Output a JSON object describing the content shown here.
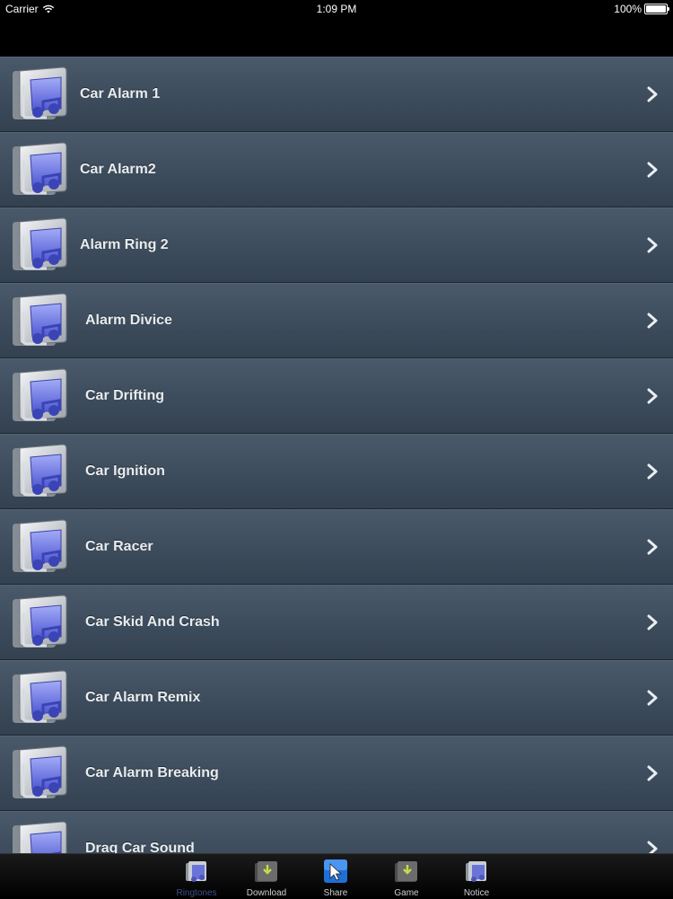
{
  "status": {
    "carrier": "Carrier",
    "time": "1:09 PM",
    "battery": "100%"
  },
  "rows": [
    {
      "label": "Car Alarm 1"
    },
    {
      "label": "Car Alarm2"
    },
    {
      "label": "Alarm Ring 2"
    },
    {
      "label": "Alarm Divice"
    },
    {
      "label": "Car Drifting"
    },
    {
      "label": "Car Ignition"
    },
    {
      "label": "Car Racer"
    },
    {
      "label": "Car Skid And Crash"
    },
    {
      "label": "Car Alarm Remix"
    },
    {
      "label": "Car Alarm Breaking"
    },
    {
      "label": "Drag Car Sound"
    }
  ],
  "tabs": [
    {
      "label": "Ringtones",
      "icon": "music-folder-icon",
      "active": true
    },
    {
      "label": "Download",
      "icon": "download-folder-icon"
    },
    {
      "label": "Share",
      "icon": "share-cursor-icon"
    },
    {
      "label": "Game",
      "icon": "game-folder-icon"
    },
    {
      "label": "Notice",
      "icon": "notice-folder-icon"
    }
  ],
  "colors": {
    "row_top": "#4a5a6b",
    "row_bottom": "#334150",
    "text": "#e8ecef",
    "tab_active": "#3c4f8a"
  }
}
